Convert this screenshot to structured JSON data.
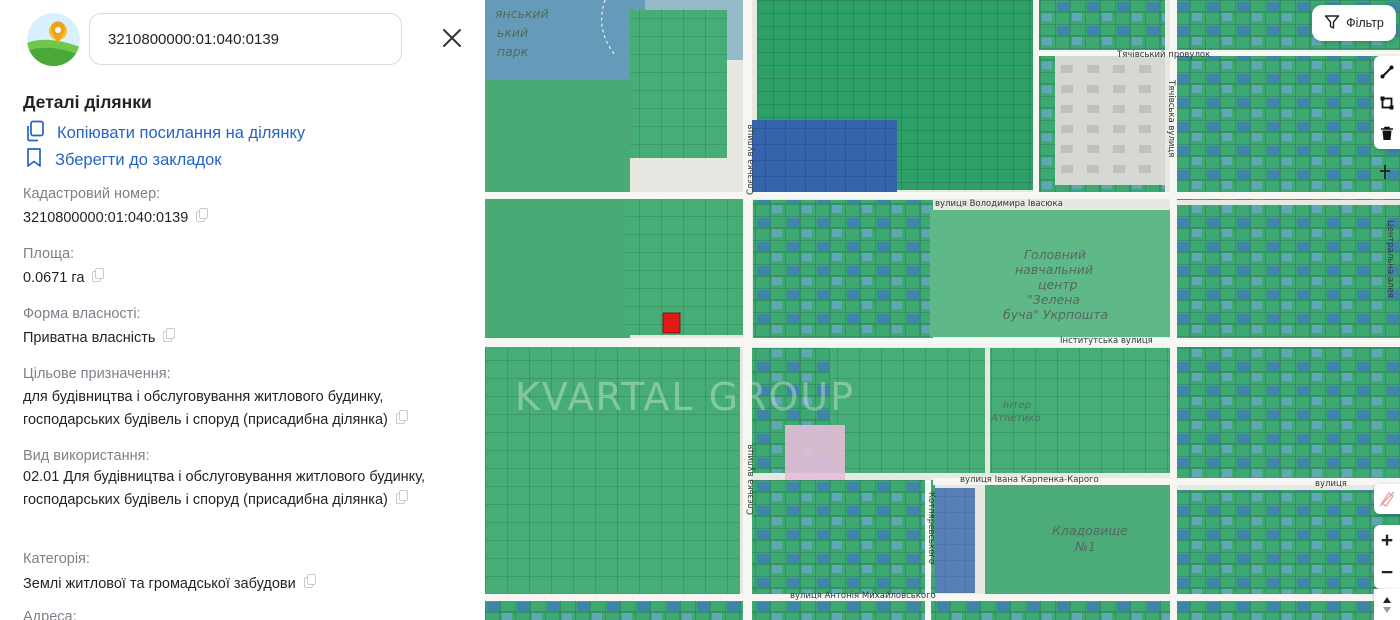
{
  "search": {
    "value": "3210800000:01:040:0139"
  },
  "details": {
    "title": "Деталі ділянки",
    "copy_link_label": "Копіювати посилання на ділянку",
    "bookmark_label": "Зберегти до закладок",
    "fields": [
      {
        "label": "Кадастровий номер:",
        "value": "3210800000:01:040:0139"
      },
      {
        "label": "Площа:",
        "value": "0.0671 га"
      },
      {
        "label": "Форма власності:",
        "value": "Приватна власність"
      },
      {
        "label": "Цільове призначення:",
        "value": "для будівництва і обслуговування житлового будинку, господарських будівель і споруд (присадибна ділянка)"
      },
      {
        "label": "Вид використання:",
        "value": "02.01 Для будівництва і обслуговування житлового будинку, господарських будівель і споруд (присадибна ділянка)"
      },
      {
        "label": "Категорія:",
        "value": "Землі житлової та громадської забудови"
      },
      {
        "label": "Адреса:",
        "value": ""
      }
    ]
  },
  "map": {
    "filter_label": "Фільтр",
    "watermark": "KVARTAL GROUP",
    "streets": {
      "tiachivskyi": "Тячівський провулок",
      "tiachivska": "Тячівська вулиця",
      "ivasiuka": "вулиця Володимира Івасюка",
      "sleziaka_top": "Слєзька вулиця",
      "sleziaka_bottom": "Слєзька вулиця",
      "instytutska": "Інститутська вулиця",
      "karpenka": "вулиця Івана Карпенка-Карого",
      "tsentralna": "Центральна алея",
      "mykhailovskoho": "вулиця Антонія Михайловського",
      "kotsiubynskoho": "Котляревського",
      "right_street": "вулиця"
    },
    "park_label": [
      "янський",
      "ький",
      "парк"
    ],
    "center_label": [
      "Головний",
      "навчальний",
      "центр",
      "\"Зелена",
      "буча\" Укрпошта"
    ],
    "inter_label": [
      "Інтер",
      "Атлетико"
    ],
    "cemetery_label": [
      "Кладовище",
      "№1"
    ],
    "selected_parcel_color": "#e11919",
    "parcel_color": "#3aa56f",
    "accent_blue": "#2563c9"
  },
  "icons": [
    "app-logo-icon",
    "close-icon",
    "copy-link-icon",
    "bookmark-icon",
    "copy-icon",
    "filter-icon",
    "line-tool-icon",
    "polygon-tool-icon",
    "trash-icon",
    "compass-icon",
    "erase-icon",
    "zoom-in-icon",
    "zoom-out-icon",
    "north-arrow-icon"
  ]
}
